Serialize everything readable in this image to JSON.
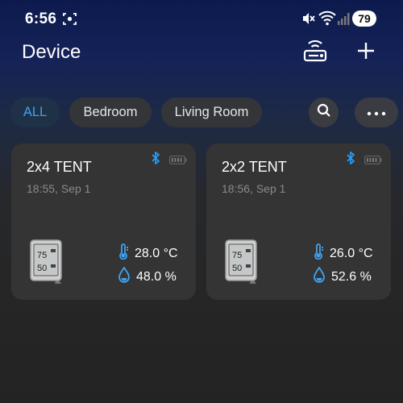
{
  "status_bar": {
    "time": "6:56",
    "battery": "79"
  },
  "header": {
    "title": "Device"
  },
  "filters": [
    {
      "label": "ALL",
      "active": true
    },
    {
      "label": "Bedroom",
      "active": false
    },
    {
      "label": "Living Room",
      "active": false
    }
  ],
  "devices": [
    {
      "name": "2x4 TENT",
      "time": "18:55, Sep 1",
      "temperature": "28.0 °C",
      "humidity": "48.0 %",
      "display_top": "75",
      "display_bottom": "50"
    },
    {
      "name": "2x2 TENT",
      "time": "18:56, Sep 1",
      "temperature": "26.0 °C",
      "humidity": "52.6 %",
      "display_top": "75",
      "display_bottom": "50"
    }
  ],
  "colors": {
    "accent": "#3fa2f0",
    "card": "#343434",
    "chip": "#333539",
    "bluetooth": "#2a9df4"
  },
  "icons": {
    "screenshot": "screen-capture-icon",
    "mute": "mute-icon",
    "wifi": "wifi-icon",
    "signal": "signal-icon",
    "gateway": "gateway-icon",
    "add": "plus-icon",
    "search": "search-icon",
    "more": "more-icon",
    "bluetooth": "bluetooth-icon",
    "device_battery": "battery-icon",
    "thermometer": "thermometer-icon",
    "humidity": "humidity-icon"
  }
}
